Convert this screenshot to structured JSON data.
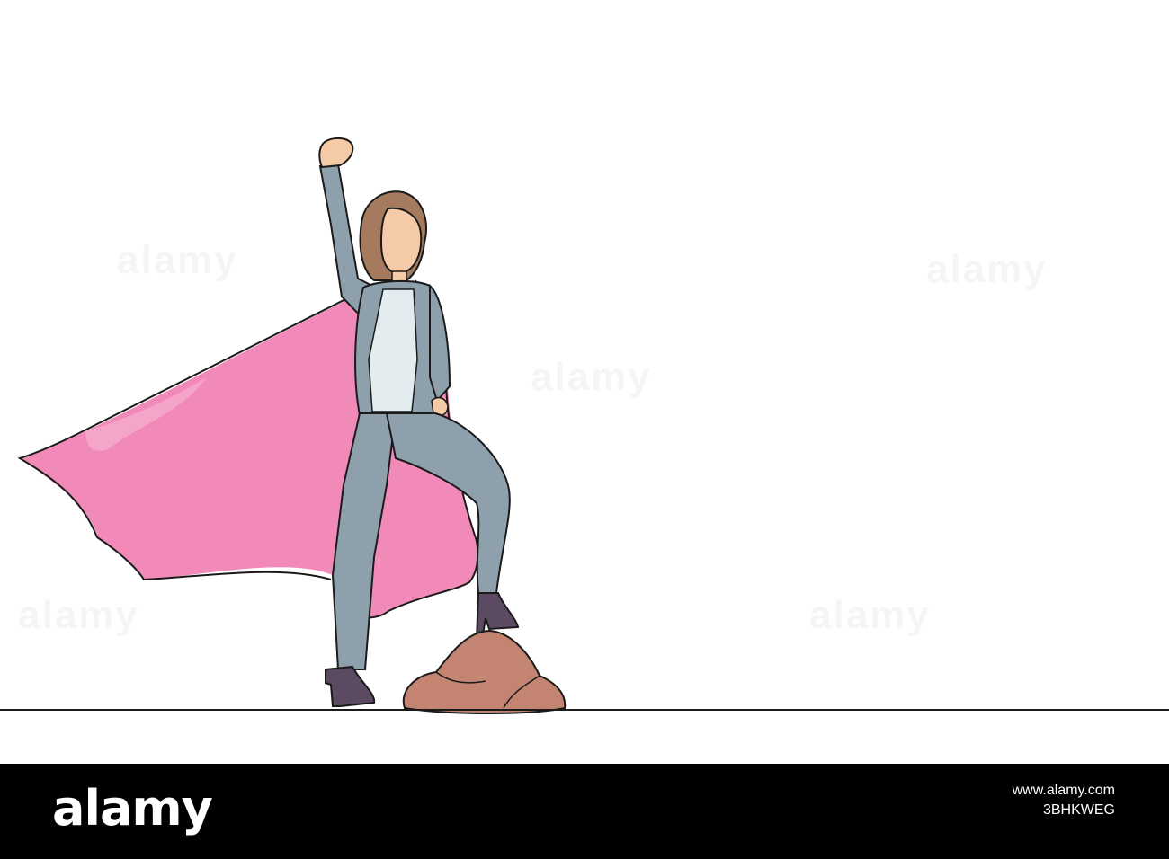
{
  "illustration": {
    "subject": "businesswoman-superhero",
    "colors": {
      "cape": "#f28ab9",
      "cape_light": "#f6a9cc",
      "suit": "#8fa0ad",
      "shirt": "#e3ecef",
      "hair": "#a57a5e",
      "skin": "#f5cba7",
      "shoe": "#5c4a63",
      "rock": "#c48472",
      "line": "#1a1a1a"
    }
  },
  "watermark": {
    "text": "alamy"
  },
  "footer": {
    "logo": "alamy",
    "image_id_line1": "www.alamy.com",
    "image_id_line2": "3BHKWEG"
  }
}
